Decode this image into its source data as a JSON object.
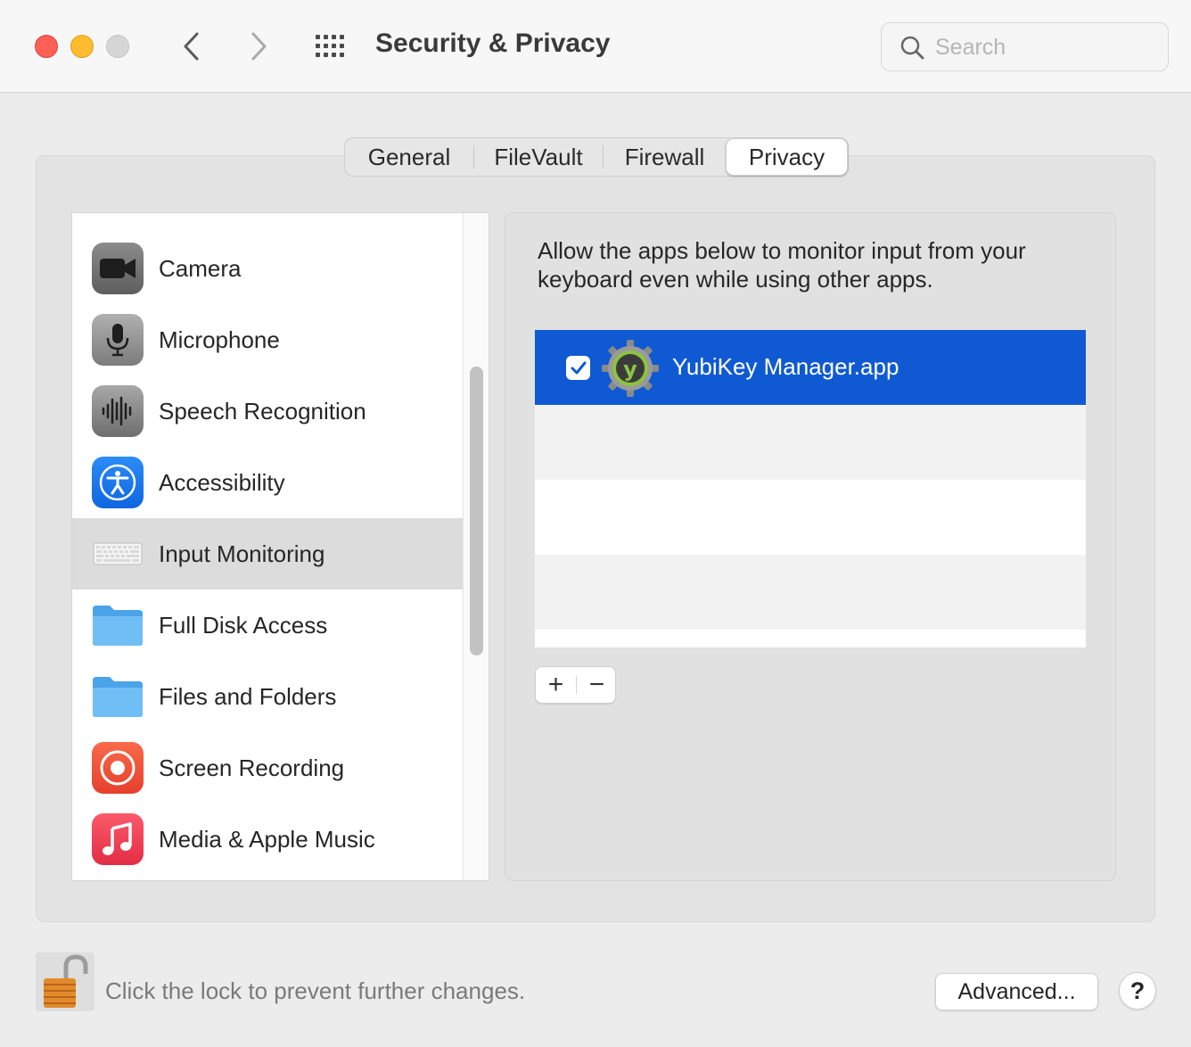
{
  "window": {
    "title": "Security & Privacy"
  },
  "search": {
    "placeholder": "Search",
    "value": ""
  },
  "tabs": [
    {
      "label": "General",
      "active": false
    },
    {
      "label": "FileVault",
      "active": false
    },
    {
      "label": "Firewall",
      "active": false
    },
    {
      "label": "Privacy",
      "active": true
    }
  ],
  "sidebar": {
    "items": [
      {
        "label": "Camera",
        "icon": "camera-icon"
      },
      {
        "label": "Microphone",
        "icon": "microphone-icon"
      },
      {
        "label": "Speech Recognition",
        "icon": "waveform-icon"
      },
      {
        "label": "Accessibility",
        "icon": "accessibility-icon"
      },
      {
        "label": "Input Monitoring",
        "icon": "keyboard-icon",
        "selected": true
      },
      {
        "label": "Full Disk Access",
        "icon": "folder-icon"
      },
      {
        "label": "Files and Folders",
        "icon": "folder-icon"
      },
      {
        "label": "Screen Recording",
        "icon": "screen-recording-icon"
      },
      {
        "label": "Media & Apple Music",
        "icon": "music-note-icon"
      }
    ]
  },
  "detail": {
    "description": "Allow the apps below to monitor input from your keyboard even while using other apps.",
    "apps": [
      {
        "name": "YubiKey Manager.app",
        "checked": true,
        "icon": "yubikey-logo"
      }
    ],
    "add_label": "+",
    "remove_label": "−"
  },
  "footer": {
    "lock_message": "Click the lock to prevent further changes.",
    "advanced_label": "Advanced...",
    "help_label": "?"
  },
  "colors": {
    "selection_blue": "#0f5ad3",
    "close": "#fe5f57",
    "minimize": "#febc2e"
  }
}
